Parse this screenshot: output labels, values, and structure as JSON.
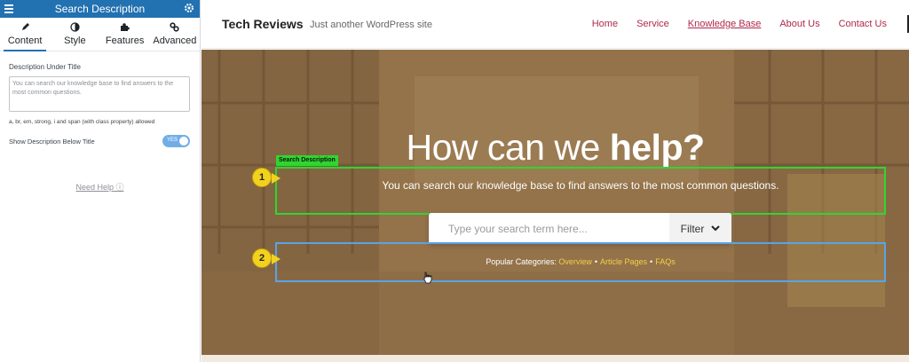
{
  "panel": {
    "title": "Search Description",
    "tabs": [
      {
        "label": "Content"
      },
      {
        "label": "Style"
      },
      {
        "label": "Features"
      },
      {
        "label": "Advanced"
      }
    ],
    "field_label": "Description Under Title",
    "field_value": "You can search our knowledge base to find answers to the most common questions.",
    "hint": "a, br, em, strong, i and span (with class property) allowed",
    "toggle_label": "Show Description Below Title",
    "toggle_value": "YES",
    "help_link": "Need Help ⓘ"
  },
  "site": {
    "title": "Tech Reviews",
    "tagline": "Just another WordPress site",
    "nav": [
      {
        "label": "Home"
      },
      {
        "label": "Service"
      },
      {
        "label": "Knowledge Base"
      },
      {
        "label": "About Us"
      },
      {
        "label": "Contact Us"
      }
    ]
  },
  "hero": {
    "title_regular": "How can we",
    "title_bold": "help?",
    "description_tag": "Search Description",
    "description": "You can search our knowledge base to find answers to the most common questions.",
    "search_placeholder": "Type your search term here...",
    "filter_label": "Filter",
    "popular_prefix": "Popular Categories:",
    "categories": [
      "Overview",
      "Article Pages",
      "FAQs"
    ]
  },
  "callouts": [
    "1",
    "2"
  ],
  "colors": {
    "panel_header": "#2271b1",
    "nav_link": "#b0294b",
    "highlight_green": "#2fd630",
    "highlight_blue": "#5aa3e6",
    "callout_yellow": "#f3d21e",
    "category_link": "#f1d04a"
  }
}
